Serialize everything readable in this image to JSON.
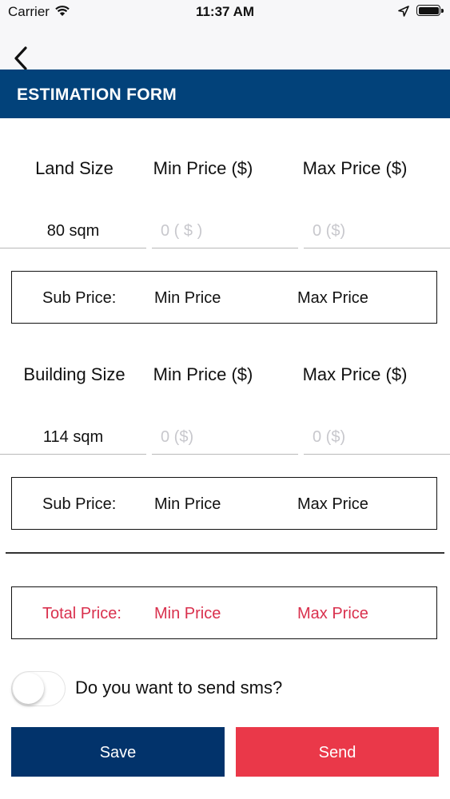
{
  "status_bar": {
    "carrier": "Carrier",
    "time": "11:37 AM"
  },
  "header": {
    "title": "ESTIMATION FORM"
  },
  "land": {
    "labels": [
      "Land Size",
      "Min Price ($)",
      "Max Price ($)"
    ],
    "size_value": "80 sqm",
    "min_placeholder": "0 ( $ )",
    "max_placeholder": "0 ($)",
    "sub": {
      "label": "Sub Price:",
      "min": "Min Price",
      "max": "Max Price"
    }
  },
  "building": {
    "labels": [
      "Building Size",
      "Min Price ($)",
      "Max Price ($)"
    ],
    "size_value": "114 sqm",
    "min_placeholder": "0 ($)",
    "max_placeholder": "0 ($)",
    "sub": {
      "label": "Sub Price:",
      "min": "Min Price",
      "max": "Max Price"
    }
  },
  "total": {
    "label": "Total Price:",
    "min": "Min Price",
    "max": "Max Price"
  },
  "sms": {
    "label": "Do you want to send sms?",
    "enabled": false
  },
  "actions": {
    "save": "Save",
    "send": "Send"
  },
  "colors": {
    "header": "#02427a",
    "save": "#02336b",
    "send": "#ea3849",
    "total_text": "#d9304d"
  },
  "icons": [
    "wifi-icon",
    "location-arrow-icon",
    "battery-icon",
    "back-chevron-icon"
  ]
}
